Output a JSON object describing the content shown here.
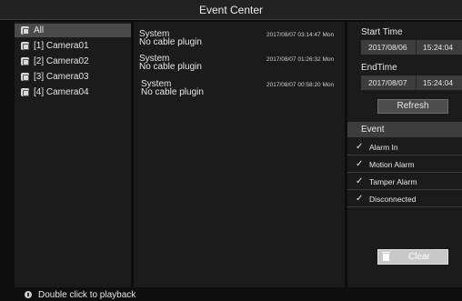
{
  "window": {
    "title": "Event Center"
  },
  "cameras": [
    {
      "label": "All",
      "selected": true
    },
    {
      "label": "[1] Camera01",
      "selected": false
    },
    {
      "label": "[2] Camera02",
      "selected": false
    },
    {
      "label": "[3] Camera03",
      "selected": false
    },
    {
      "label": "[4] Camera04",
      "selected": false
    }
  ],
  "events": [
    {
      "name": "System",
      "desc": "No cable plugin",
      "time": "2017/08/07 03:14:47 Mon"
    },
    {
      "name": "System",
      "desc": "No cable plugin",
      "time": "2017/08/07 01:26:32 Mon"
    },
    {
      "name": "System",
      "desc": "No cable plugin",
      "time": "2017/08/07 00:58:20 Mon"
    }
  ],
  "filter": {
    "start_label": "Start Time",
    "start_date": "2017/08/06",
    "start_time": "15:24:04",
    "end_label": "EndTime",
    "end_date": "2017/08/07",
    "end_time": "15:24:04",
    "refresh_label": "Refresh",
    "event_header": "Event",
    "check_mark": "✓",
    "event_types": [
      {
        "label": "Alarm In",
        "checked": true
      },
      {
        "label": "Motion Alarm",
        "checked": true
      },
      {
        "label": "Tamper Alarm",
        "checked": true
      },
      {
        "label": "Disconnected",
        "checked": true
      }
    ],
    "clear_label": "Clear"
  },
  "status": {
    "hint": "Double click to playback"
  }
}
